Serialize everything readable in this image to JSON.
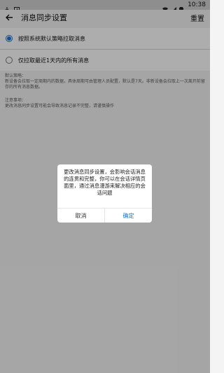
{
  "statusbar": {
    "time": "10:38",
    "icons": [
      "download-icon",
      "alert-icon",
      "wifi-icon",
      "signal-icon",
      "battery-icon"
    ]
  },
  "appbar": {
    "back_icon": "back-arrow-icon",
    "title": "消息同步设置",
    "reset_label": "重置"
  },
  "options": [
    {
      "label": "按照系统默认策略拉取消息",
      "checked": true
    },
    {
      "label": "仅拉取最近1天内的所有消息",
      "checked": false
    }
  ],
  "info": {
    "default_title": "默认策略：",
    "default_body": "新设备会拉取一定周期内的数据，具体周期可由管理人员配置，默认是7天。非新设备会拉取上一次离开前留存的所有消息数据。",
    "notice_title": "注意事项：",
    "notice_body": "更改消息同步设置可能会导致消息记录不完整，请谨慎操作"
  },
  "dialog": {
    "message": "更改消息同步设置，会影响会话消息的连贯和完整，你可以在会话详情页面里，通过消息漫游来解决相应的会话问题",
    "cancel_label": "取消",
    "confirm_label": "确定"
  },
  "colors": {
    "accent": "#1d74d6",
    "background": "#f4f4f4",
    "overlay": "rgba(0,0,0,0.32)"
  }
}
